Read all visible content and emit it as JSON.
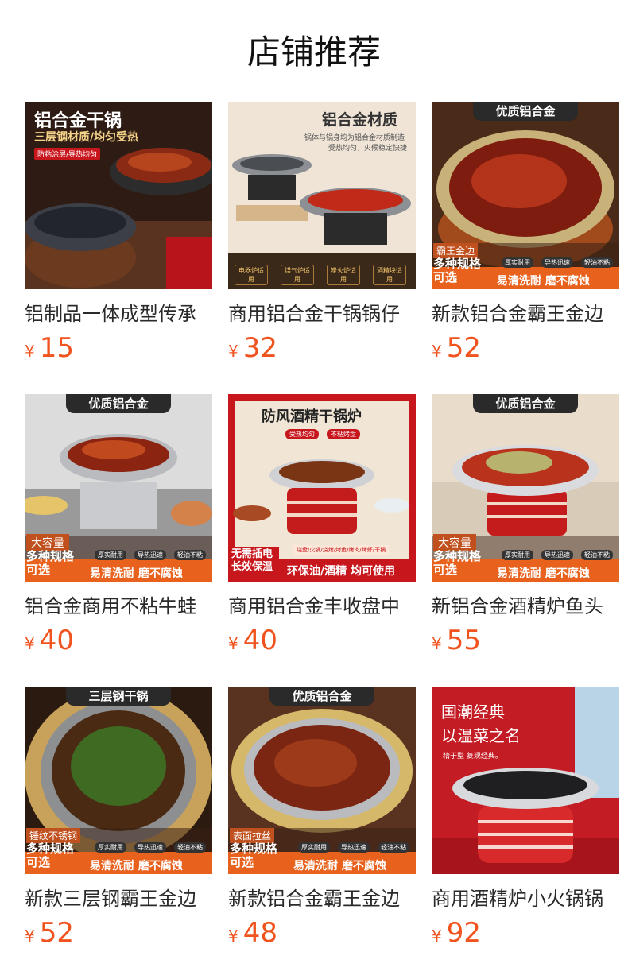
{
  "page": {
    "title": "店铺推荐"
  },
  "currency_symbol": "¥",
  "products": [
    {
      "name": "铝制品一体成型传承",
      "price": "15",
      "image": {
        "headline": "铝合金干锅",
        "subline": "三层钢材质/均匀受热",
        "tag": "防粘涂层/导热均匀"
      }
    },
    {
      "name": "商用铝合金干锅锅仔",
      "price": "32",
      "image": {
        "headline": "铝合金材质",
        "subline": "锅体与锅身均为铝合金材质制造",
        "subline2": "受热均匀，火候稳定快捷",
        "badges": [
          "电器炉适用",
          "煤气炉适用",
          "炭火炉适用",
          "酒精块适用"
        ]
      }
    },
    {
      "name": "新款铝合金霸王金边",
      "price": "52",
      "image": {
        "banner": "优质铝合金",
        "corner": "霸王金边",
        "spec": "多种规格可选",
        "chips": [
          "厚实耐用",
          "导热迅速",
          "轻油不粘"
        ],
        "slogan": "易清洗耐 磨不腐蚀"
      }
    },
    {
      "name": "铝合金商用不粘牛蛙",
      "price": "40",
      "image": {
        "banner": "优质铝合金",
        "corner": "大容量",
        "spec": "多种规格可选",
        "chips": [
          "厚实耐用",
          "导热迅速",
          "轻油不粘"
        ],
        "slogan": "易清洗耐 磨不腐蚀"
      }
    },
    {
      "name": "商用铝合金丰收盘中",
      "price": "40",
      "image": {
        "headline": "防风酒精干锅炉",
        "pills": [
          "受热均匀",
          "不粘烤盘"
        ],
        "corner": "无需插电长效保温",
        "strip": "烧盘/火锅/烧烤/烤鱼/烤肉/烤虾/干锅",
        "slogan": "环保油/酒精 均可使用"
      }
    },
    {
      "name": "新铝合金酒精炉鱼头",
      "price": "55",
      "image": {
        "banner": "优质铝合金",
        "corner": "大容量",
        "spec": "多种规格可选",
        "chips": [
          "厚实耐用",
          "导热迅速",
          "轻油不粘"
        ],
        "slogan": "易清洗耐 磨不腐蚀"
      }
    },
    {
      "name": "新款三层钢霸王金边",
      "price": "52",
      "image": {
        "banner": "三层钢干锅",
        "corner": "锤纹不锈钢",
        "spec": "多种规格可选",
        "chips": [
          "厚实耐用",
          "导热迅速",
          "轻油不粘"
        ],
        "slogan": "易清洗耐 磨不腐蚀"
      }
    },
    {
      "name": "新款铝合金霸王金边",
      "price": "48",
      "image": {
        "banner": "优质铝合金",
        "corner": "表面拉丝",
        "spec": "多种规格可选",
        "chips": [
          "厚实耐用",
          "导热迅速",
          "轻油不粘"
        ],
        "slogan": "易清洗耐 磨不腐蚀"
      }
    },
    {
      "name": "商用酒精炉小火锅锅",
      "price": "92",
      "image": {
        "headline1": "国潮经典",
        "headline2": "以温菜之名",
        "subline": "精于型 复现经典。"
      }
    }
  ],
  "colors": {
    "price": "#f1531f",
    "accent_red": "#c8161d",
    "banner_dark": "#2a2a2a",
    "slogan_orange": "#e8621e"
  }
}
